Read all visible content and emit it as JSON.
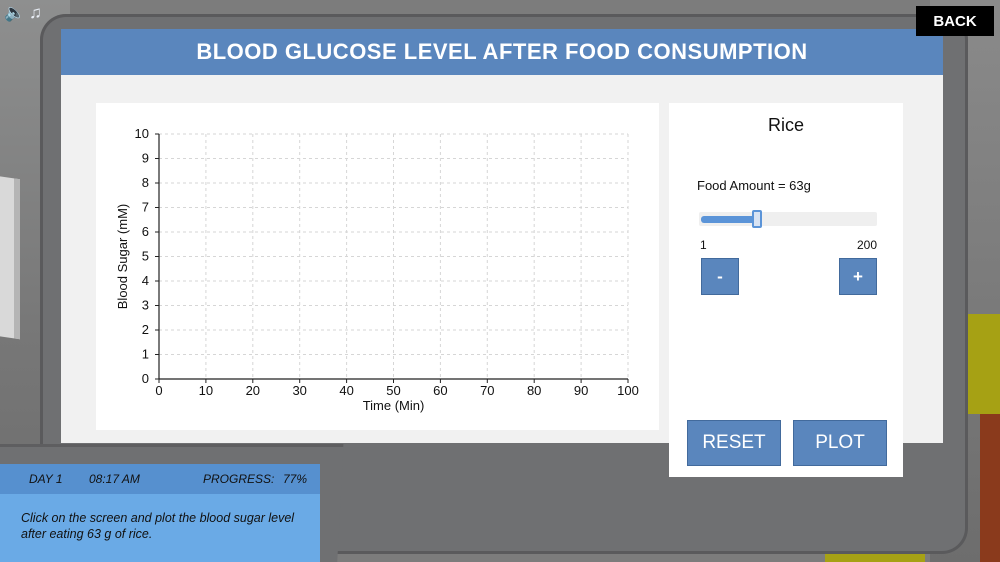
{
  "header": {
    "title": "BLOOD GLUCOSE LEVEL AFTER FOOD CONSUMPTION",
    "back_label": "BACK"
  },
  "top_icons": {
    "sound": "🔈",
    "music": "♫"
  },
  "chart_data": {
    "type": "line",
    "title": "",
    "xlabel": "Time (Min)",
    "ylabel": "Blood Sugar (mM)",
    "xlim": [
      0,
      100
    ],
    "ylim": [
      0,
      10
    ],
    "x_ticks": [
      "0",
      "10",
      "20",
      "30",
      "40",
      "50",
      "60",
      "70",
      "80",
      "90",
      "100"
    ],
    "y_ticks": [
      "0",
      "1",
      "2",
      "3",
      "4",
      "5",
      "6",
      "7",
      "8",
      "9",
      "10"
    ],
    "grid": true,
    "series": []
  },
  "controls": {
    "food_name": "Rice",
    "food_amount_text": "Food Amount = 63g",
    "slider": {
      "min_label": "1",
      "max_label": "200",
      "min": 1,
      "max": 200,
      "value": 63
    },
    "minus_label": "-",
    "plus_label": "+",
    "reset_label": "RESET",
    "plot_label": "PLOT"
  },
  "status": {
    "day": "DAY 1",
    "time": "08:17 AM",
    "progress_label": "PROGRESS:",
    "progress_value": "77%",
    "instruction": "Click on the screen and plot the blood sugar level after eating 63 g of rice."
  },
  "colors": {
    "accent": "#5a86bd",
    "status_bar": "#5690cf",
    "instruction_bg": "#6aaae6",
    "slider_fill": "#5b94d8"
  }
}
